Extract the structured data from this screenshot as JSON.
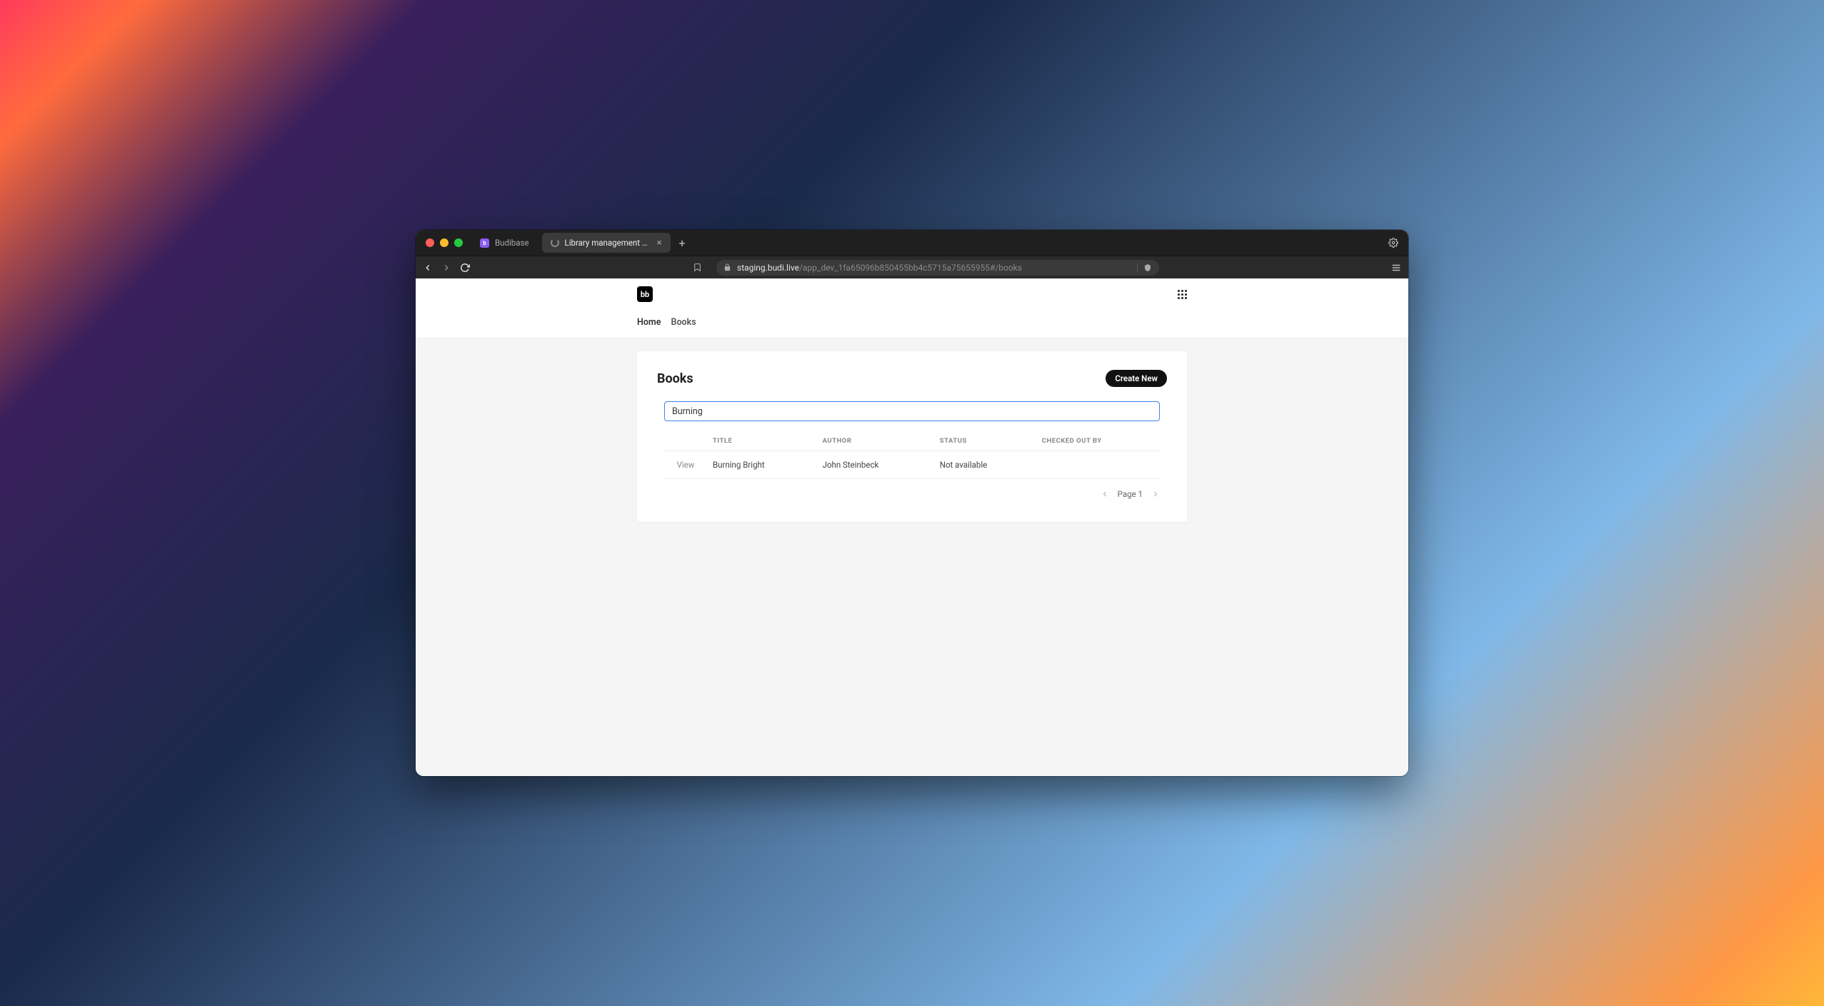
{
  "browser": {
    "tabs": [
      {
        "title": "Budibase",
        "active": false,
        "favicon": "budibase"
      },
      {
        "title": "Library management app",
        "active": true,
        "favicon": "loading"
      }
    ],
    "url_host": "staging.budi.live",
    "url_path": "/app_dev_1fa65096b850455bb4c5715a75655955#/books"
  },
  "app": {
    "logo_text": "bb",
    "nav": {
      "home": "Home",
      "books": "Books"
    }
  },
  "page": {
    "title": "Books",
    "create_button": "Create New",
    "search_value": "Burning",
    "columns": {
      "view": "",
      "title": "TITLE",
      "author": "AUTHOR",
      "status": "STATUS",
      "checked_out_by": "CHECKED OUT BY"
    },
    "rows": [
      {
        "view_label": "View",
        "title": "Burning Bright",
        "author": "John Steinbeck",
        "status": "Not available",
        "checked_out_by": ""
      }
    ],
    "pagination_label": "Page 1"
  }
}
